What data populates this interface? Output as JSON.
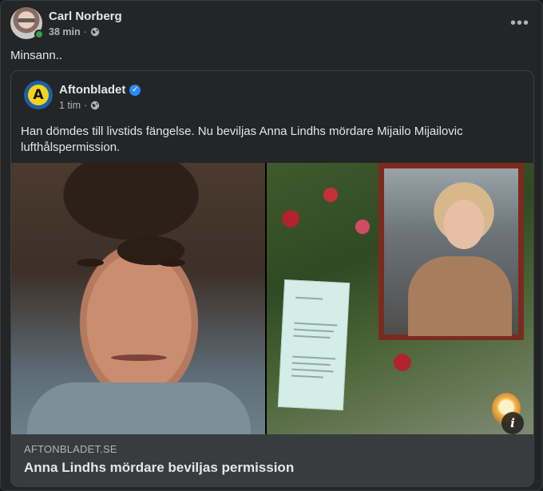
{
  "post": {
    "author": "Carl Norberg",
    "time": "38 min",
    "separator": "·",
    "audience_icon": "globe-icon",
    "more_icon": "more-horizontal-icon",
    "more_label": "•••",
    "text": "Minsann.."
  },
  "shared_post": {
    "page_name": "Aftonbladet",
    "page_logo_letter": "A",
    "verified_icon": "verified-badge-icon",
    "verified_glyph": "✓",
    "time": "1 tim",
    "separator": "·",
    "audience_icon": "globe-icon",
    "text": "Han dömdes till livstids fängelse. Nu beviljas Anna Lindhs mördare Mijailo Mijailovic lufthålspermission.",
    "info_glyph": "i",
    "link": {
      "domain": "AFTONBLADET.SE",
      "title": "Anna Lindhs mördare beviljas permission"
    }
  },
  "colors": {
    "background": "#242526",
    "text_primary": "#e4e6eb",
    "text_secondary": "#b0b3b8",
    "link_footer_bg": "#3a3b3c",
    "verified_blue": "#2d88ff",
    "online_green": "#31a24c",
    "brand_yellow": "#f5d31d",
    "brand_blue": "#1d5fa8"
  }
}
